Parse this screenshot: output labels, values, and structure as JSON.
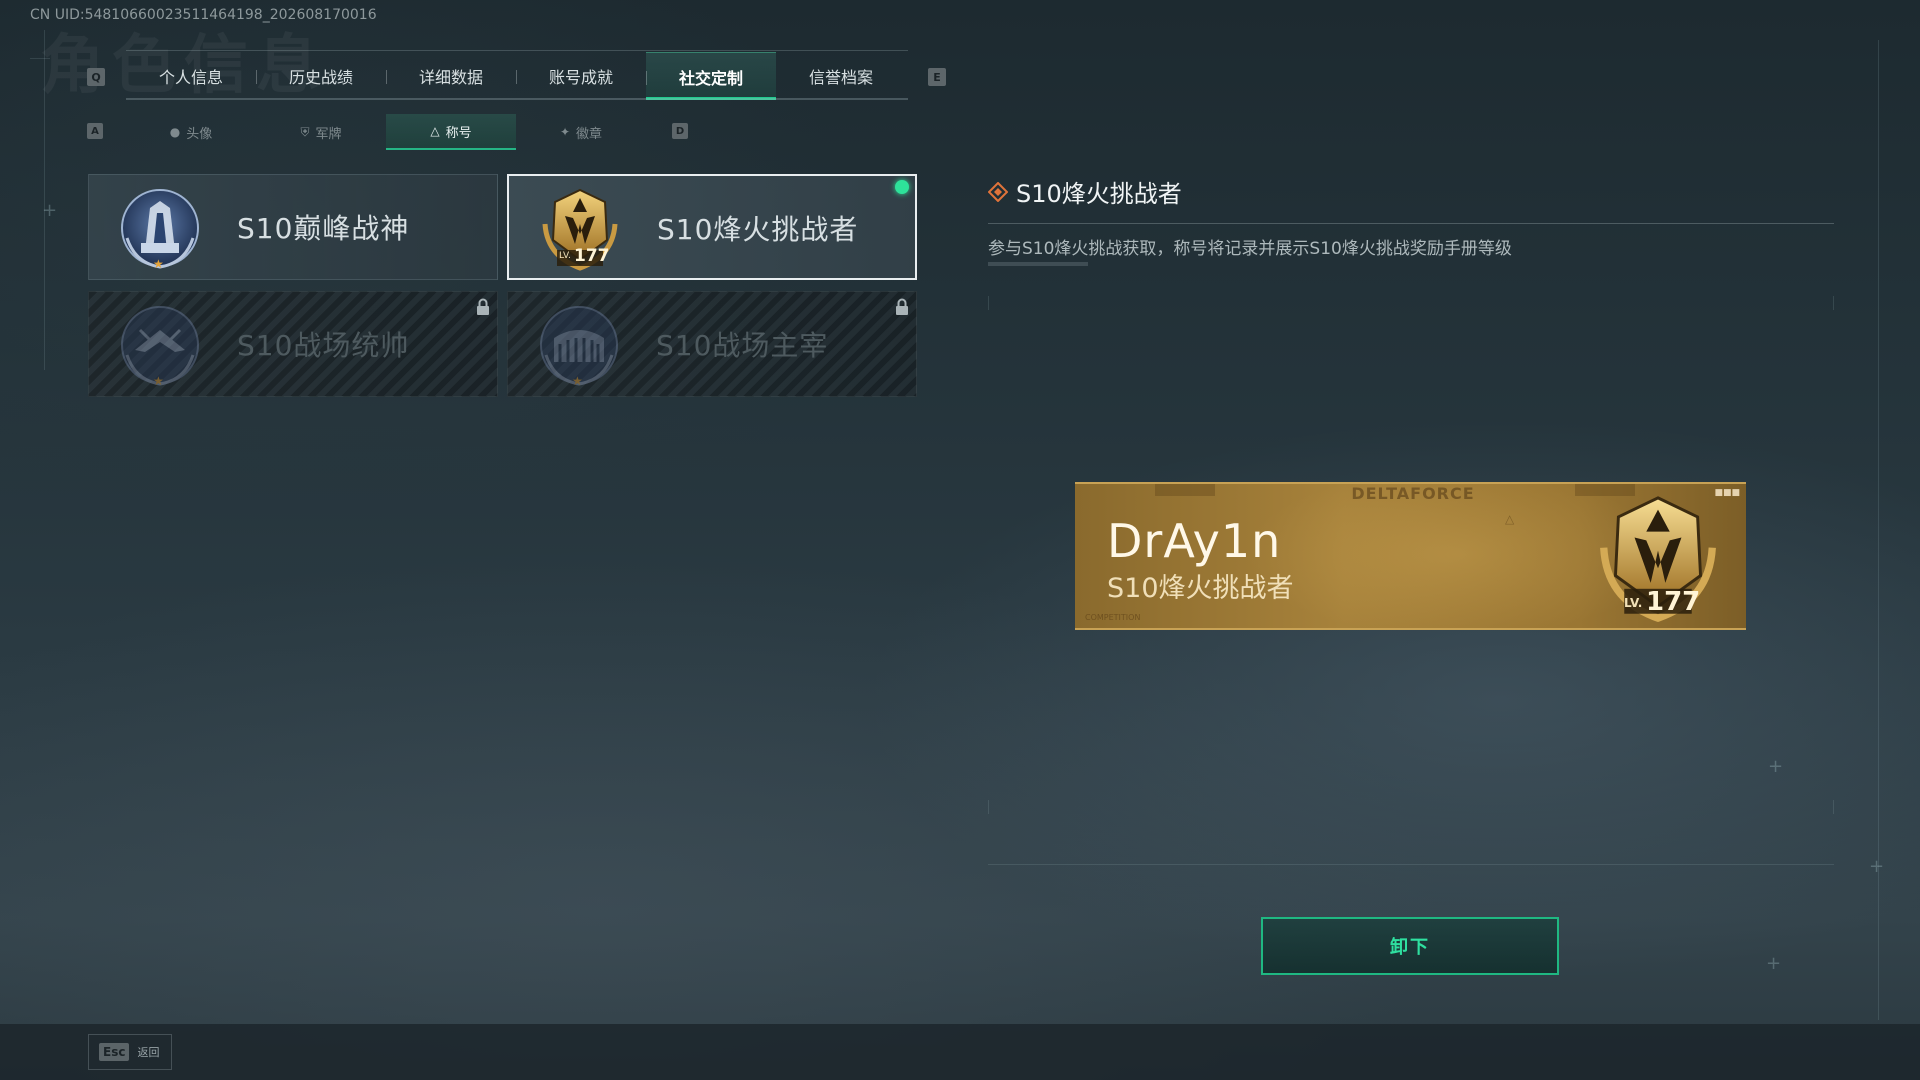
{
  "uid": "CN UID:54810660023511464198_202608170016",
  "bg_title": "角色信息",
  "keys": {
    "prev_tab": "Q",
    "next_tab": "E",
    "prev_sub": "A",
    "next_sub": "D"
  },
  "tabs": [
    {
      "label": "个人信息",
      "active": false
    },
    {
      "label": "历史战绩",
      "active": false
    },
    {
      "label": "详细数据",
      "active": false
    },
    {
      "label": "账号成就",
      "active": false
    },
    {
      "label": "社交定制",
      "active": true
    },
    {
      "label": "信誉档案",
      "active": false
    }
  ],
  "subtabs": [
    {
      "label": "头像",
      "icon": "person-icon",
      "active": false
    },
    {
      "label": "军牌",
      "icon": "shield-icon",
      "active": false
    },
    {
      "label": "称号",
      "icon": "triangle-icon",
      "active": true
    },
    {
      "label": "徽章",
      "icon": "wings-icon",
      "active": false
    }
  ],
  "titles": [
    {
      "label": "S10巅峰战神",
      "icon": "peak-war-god-badge-icon",
      "locked": false,
      "selected": false,
      "equipped": false
    },
    {
      "label": "S10烽火挑战者",
      "icon": "beacon-challenger-badge-icon",
      "locked": false,
      "selected": true,
      "equipped": true,
      "badge_level": "LV.177"
    },
    {
      "label": "S10战场统帅",
      "icon": "battlefield-commander-badge-icon",
      "locked": true,
      "selected": false,
      "equipped": false
    },
    {
      "label": "S10战场主宰",
      "icon": "battlefield-dominator-badge-icon",
      "locked": true,
      "selected": false,
      "equipped": false
    }
  ],
  "detail": {
    "title": "S10烽火挑战者",
    "description": "参与S10烽火挑战获取，称号将记录并展示S10烽火挑战奖励手册等级"
  },
  "nameplate": {
    "brand": "DELTAFORCE",
    "player_name": "DrAy1n",
    "title": "S10烽火挑战者",
    "level_prefix": "LV.",
    "level": "177",
    "footer": "COMPETITION"
  },
  "actions": {
    "unequip_label": "卸下"
  },
  "footer": {
    "esc_key": "Esc",
    "back_label": "返回"
  },
  "colors": {
    "accent": "#22c88e",
    "equipped": "#2ee29a",
    "gold": "#a7823b"
  }
}
